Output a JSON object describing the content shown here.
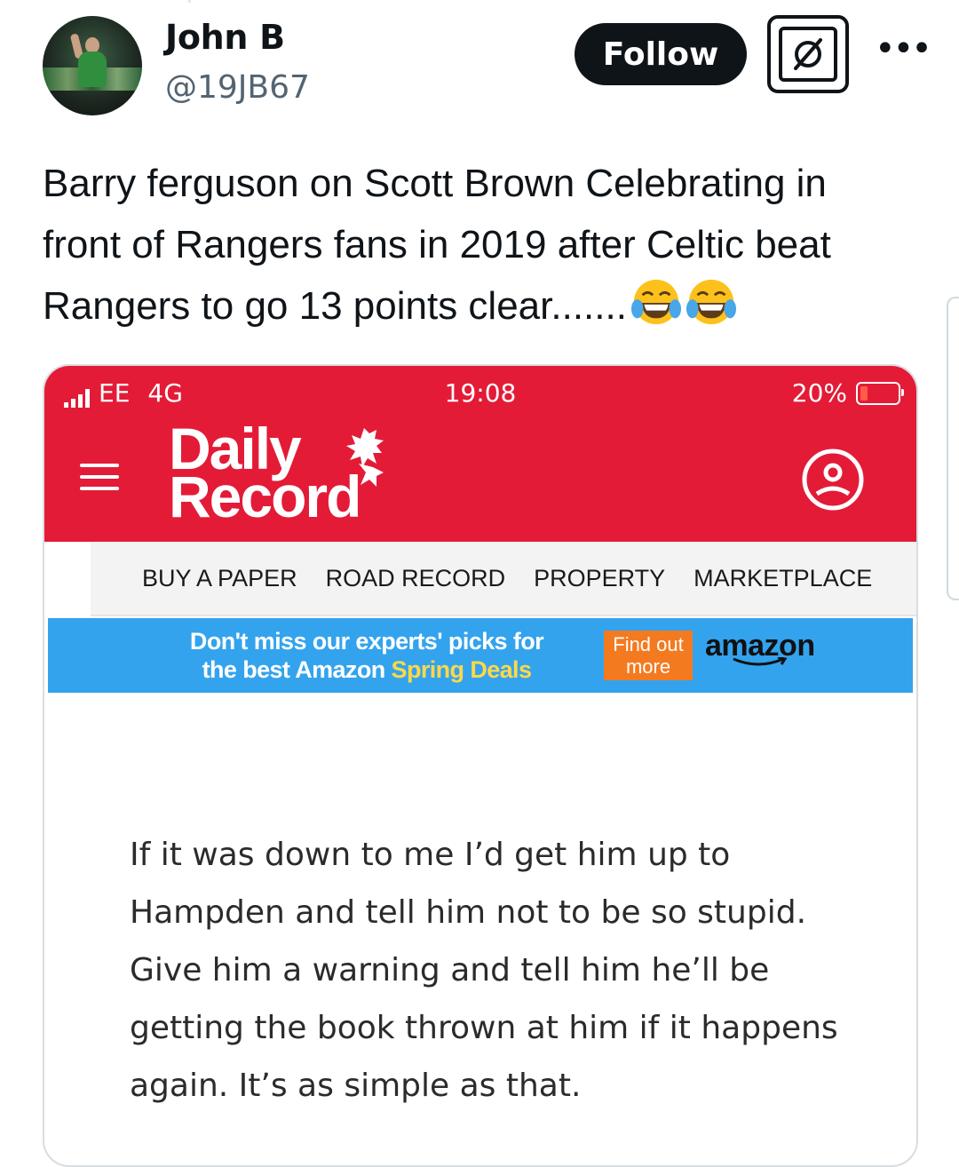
{
  "tweet": {
    "author_name": "John B",
    "author_handle": "@19JB67",
    "follow_label": "Follow",
    "more_icon": "more-dots-icon",
    "grok_icon": "grok-icon",
    "text": "Barry ferguson on Scott Brown Celebrating in front of Rangers fans in 2019 after Celtic beat Rangers to go 13 points clear.......",
    "emoji": [
      "face-with-tears-of-joy",
      "face-with-tears-of-joy"
    ]
  },
  "screenshot": {
    "status_bar": {
      "carrier": "EE",
      "network": "4G",
      "time": "19:08",
      "battery": "20%",
      "battery_level": 0.2
    },
    "header": {
      "logo_line1": "Daily",
      "logo_line2": "Record",
      "menu_icon": "hamburger-menu-icon",
      "account_icon": "user-account-icon",
      "background_color": "#e31b37"
    },
    "nav": [
      "BUY A PAPER",
      "ROAD RECORD",
      "PROPERTY",
      "MARKETPLACE"
    ],
    "promo": {
      "line1": "Don't miss our experts' picks for",
      "line2_prefix": "the best Amazon ",
      "line2_highlight": "Spring Deals",
      "cta_line1": "Find out",
      "cta_line2": "more",
      "brand": "amazon",
      "background_color": "#33a3ee",
      "cta_color": "#f47a20"
    },
    "quote": "If it was down to me I’d get him up to Hampden and tell him not to be so stupid. Give him a warning and tell him he’ll be getting the book thrown at him if it happens again. It’s as simple as that."
  }
}
